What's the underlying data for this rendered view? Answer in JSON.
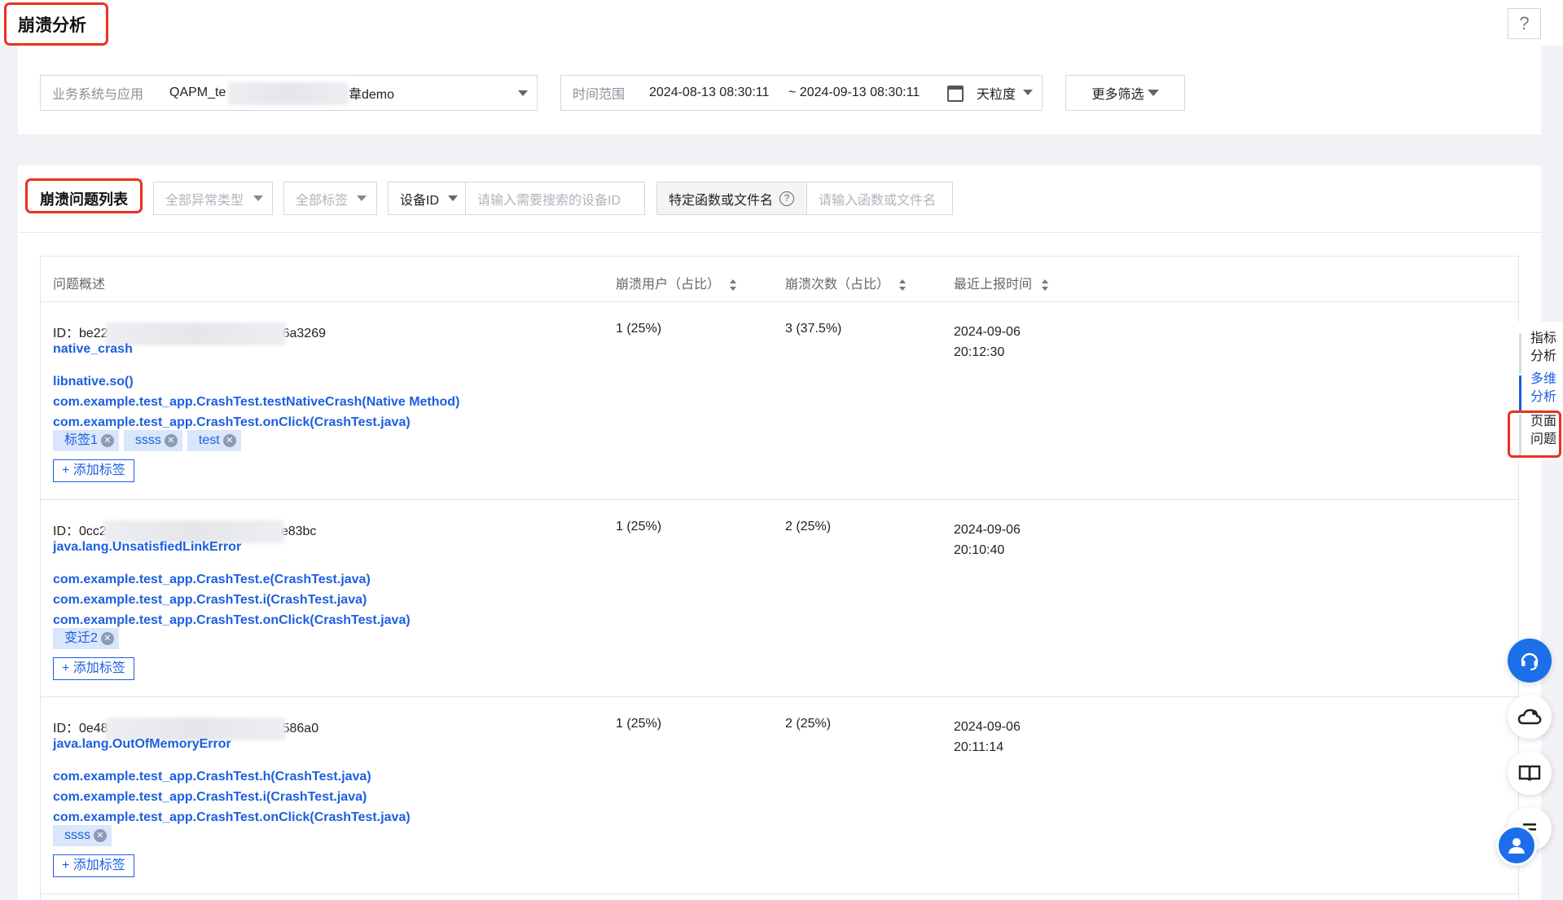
{
  "page": {
    "title": "崩溃分析",
    "help": "?"
  },
  "filters": {
    "app_label": "业务系统与应用",
    "app_value_prefix": "QAPM_te",
    "app_value_suffix": "韋demo",
    "time_label": "时间范围",
    "time_start": "2024-08-13 08:30:11",
    "time_end": "~ 2024-09-13 08:30:11",
    "granularity": "天粒度",
    "more_filters": "更多筛选"
  },
  "list": {
    "title": "崩溃问题列表",
    "exception_type": "全部异常类型",
    "all_tags": "全部标签",
    "device_select": "设备ID",
    "device_placeholder": "请输入需要搜索的设备ID",
    "func_label": "特定函数或文件名",
    "func_placeholder": "请输入函数或文件名"
  },
  "table": {
    "columns": {
      "summary": "问题概述",
      "users": "崩溃用户（占比）",
      "count": "崩溃次数（占比）",
      "last_time": "最近上报时间"
    },
    "rows": [
      {
        "id_prefix": "ID：be22",
        "id_suffix": "6a3269",
        "type": "native_crash",
        "stack": [
          "libnative.so()",
          "com.example.test_app.CrashTest.testNativeCrash(Native Method)",
          "com.example.test_app.CrashTest.onClick(CrashTest.java)"
        ],
        "tags": [
          "标签1",
          "ssss",
          "test"
        ],
        "add_tag": "+ 添加标签",
        "users": "1 (25%)",
        "count": "3 (37.5%)",
        "date": "2024-09-06",
        "time": "20:12:30"
      },
      {
        "id_prefix": "ID：0cc2",
        "id_suffix": "e83bc",
        "type": "java.lang.UnsatisfiedLinkError",
        "stack": [
          "com.example.test_app.CrashTest.e(CrashTest.java)",
          "com.example.test_app.CrashTest.i(CrashTest.java)",
          "com.example.test_app.CrashTest.onClick(CrashTest.java)"
        ],
        "tags": [
          "变迁2"
        ],
        "add_tag": "+ 添加标签",
        "users": "1 (25%)",
        "count": "2 (25%)",
        "date": "2024-09-06",
        "time": "20:10:40"
      },
      {
        "id_prefix": "ID：0e48",
        "id_suffix": "586a0",
        "type": "java.lang.OutOfMemoryError",
        "stack": [
          "com.example.test_app.CrashTest.h(CrashTest.java)",
          "com.example.test_app.CrashTest.i(CrashTest.java)",
          "com.example.test_app.CrashTest.onClick(CrashTest.java)"
        ],
        "tags": [
          "ssss"
        ],
        "add_tag": "+ 添加标签",
        "users": "1 (25%)",
        "count": "2 (25%)",
        "date": "2024-09-06",
        "time": "20:11:14"
      }
    ]
  },
  "side_nav": {
    "tabs": [
      {
        "line1": "指标",
        "line2": "分析"
      },
      {
        "line1": "多维",
        "line2": "分析"
      },
      {
        "line1": "页面",
        "line2": "问题"
      }
    ],
    "active_index": 1
  },
  "float_buttons": [
    "headset-icon",
    "cloud-icon",
    "book-icon",
    "list-icon",
    "user-icon"
  ],
  "colors": {
    "accent": "#1c5fe0",
    "highlight": "#e8321e",
    "tag_bg": "#d9e6fb"
  }
}
